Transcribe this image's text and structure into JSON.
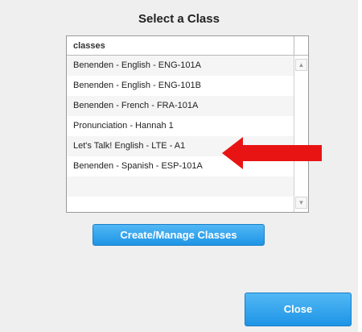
{
  "dialog": {
    "title": "Select a Class"
  },
  "list": {
    "header": "classes",
    "rows": [
      "Benenden - English - ENG-101A",
      "Benenden - English - ENG-101B",
      "Benenden - French - FRA-101A",
      "Pronunciation - Hannah 1",
      "Let's Talk! English - LTE - A1",
      "Benenden - Spanish - ESP-101A",
      "",
      ""
    ],
    "scroll_up_icon": "triangle-up",
    "scroll_down_icon": "triangle-down"
  },
  "buttons": {
    "create_manage": "Create/Manage Classes",
    "close": "Close"
  },
  "annotation": {
    "arrow_color": "#e81414",
    "arrow_icon": "arrow-left"
  },
  "colors": {
    "button_blue": "#2aa0ec",
    "panel_bg": "#efefef"
  }
}
